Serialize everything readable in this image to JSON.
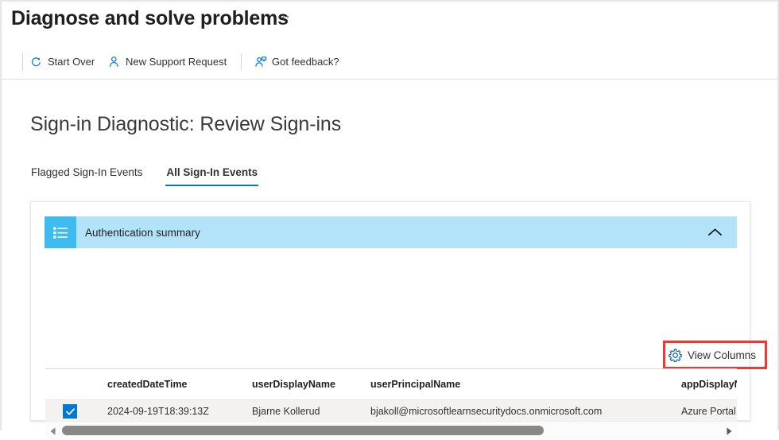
{
  "blade": {
    "title": "Diagnose and solve problems",
    "more_menu": "⋯"
  },
  "command_bar": {
    "buttons": [
      {
        "label": "Start Over",
        "icon": "refresh-icon"
      },
      {
        "label": "New Support Request",
        "icon": "person-add-icon"
      },
      {
        "label": "Got feedback?",
        "icon": "feedback-person-icon"
      }
    ]
  },
  "page": {
    "title": "Sign-in Diagnostic: Review Sign-ins"
  },
  "tabs": [
    {
      "label": "Flagged Sign-In Events",
      "selected": false
    },
    {
      "label": "All Sign-In Events",
      "selected": true
    }
  ],
  "summary": {
    "label": "Authentication summary",
    "icon": "list-icon",
    "chevron": "chevron-up-icon",
    "expanded": true
  },
  "toolbar": {
    "view_columns_label": "View Columns",
    "view_columns_icon": "gear-icon",
    "highlight_color": "#ef3a34"
  },
  "table": {
    "columns": [
      "createdDateTime",
      "userDisplayName",
      "userPrincipalName",
      "appDisplayName"
    ],
    "rows": [
      {
        "selected": true,
        "createdDateTime": "2024-09-19T18:39:13Z",
        "userDisplayName": "Bjarne Kollerud",
        "userPrincipalName": "bjakoll@microsoftlearnsecuritydocs.onmicrosoft.com",
        "appDisplayName": "Azure Portal"
      }
    ]
  },
  "scrollbar": {
    "orientation": "horizontal",
    "left_arrow": "triangle-left-icon",
    "right_arrow": "triangle-right-icon"
  },
  "colors": {
    "accent": "#0078d4",
    "banner_bg": "#b3e3f9",
    "banner_icon_bg": "#3ebbef",
    "row_bg": "#f3f2f1"
  }
}
